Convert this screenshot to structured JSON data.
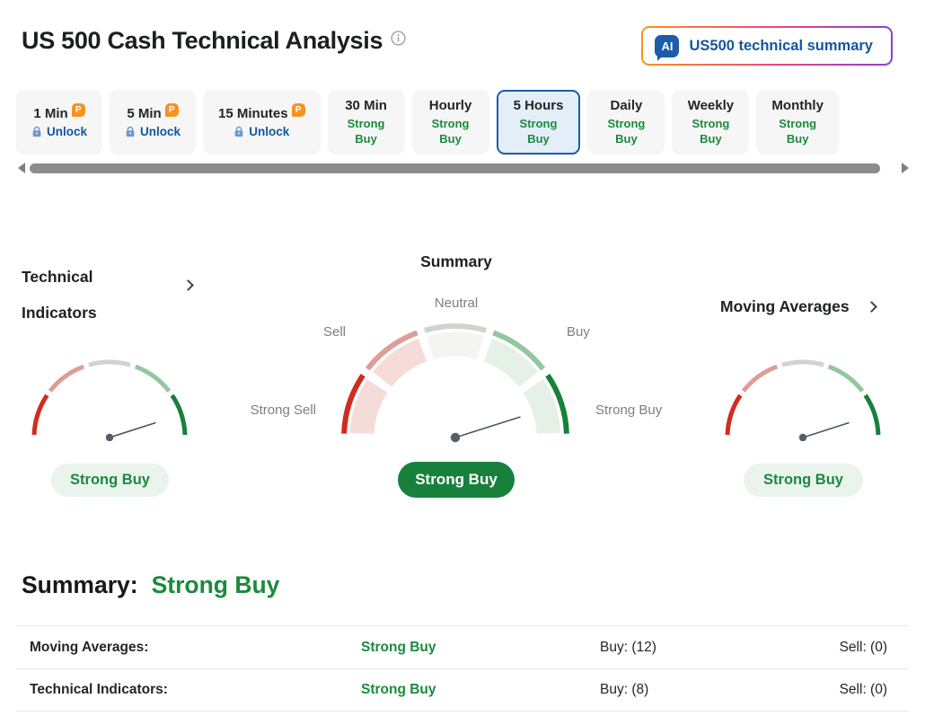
{
  "header": {
    "title": "US 500 Cash Technical Analysis",
    "ai_button": {
      "icon_label": "AI",
      "label": "US500 technical summary"
    }
  },
  "tabs": [
    {
      "label": "1 Min",
      "badge": "P",
      "status": "Unlock",
      "locked": true,
      "selected": false
    },
    {
      "label": "5 Min",
      "badge": "P",
      "status": "Unlock",
      "locked": true,
      "selected": false
    },
    {
      "label": "15 Minutes",
      "badge": "P",
      "status": "Unlock",
      "locked": true,
      "selected": false
    },
    {
      "label": "30 Min",
      "status": "Strong Buy",
      "locked": false,
      "selected": false
    },
    {
      "label": "Hourly",
      "status": "Strong Buy",
      "locked": false,
      "selected": false
    },
    {
      "label": "5 Hours",
      "status": "Strong Buy",
      "locked": false,
      "selected": true
    },
    {
      "label": "Daily",
      "status": "Strong Buy",
      "locked": false,
      "selected": false
    },
    {
      "label": "Weekly",
      "status": "Strong Buy",
      "locked": false,
      "selected": false
    },
    {
      "label": "Monthly",
      "status": "Strong Buy",
      "locked": false,
      "selected": false
    }
  ],
  "gauges": {
    "left": {
      "title": "Technical Indicators",
      "value": "Strong Buy"
    },
    "center": {
      "title": "Summary",
      "value": "Strong Buy",
      "scale_labels": {
        "strong_sell": "Strong Sell",
        "sell": "Sell",
        "neutral": "Neutral",
        "buy": "Buy",
        "strong_buy": "Strong Buy"
      }
    },
    "right": {
      "title": "Moving Averages",
      "value": "Strong Buy"
    }
  },
  "summary": {
    "heading": "Summary:",
    "value": "Strong Buy",
    "rows": [
      {
        "label": "Moving Averages:",
        "value": "Strong Buy",
        "buy": "Buy: (12)",
        "sell": "Sell: (0)"
      },
      {
        "label": "Technical Indicators:",
        "value": "Strong Buy",
        "buy": "Buy: (8)",
        "sell": "Sell: (0)"
      }
    ]
  },
  "colors": {
    "arc_strong_sell": "#D22B20",
    "arc_sell": "#DC9E97",
    "arc_neutral": "#D2D2D0",
    "arc_buy": "#92C7A0",
    "arc_strong_buy": "#17813B",
    "band_sell": "#F6DCD9",
    "band_neutral": "#F4F4F2",
    "band_buy": "#E5F1E7",
    "needle": "#4C5564",
    "pivot": "#535D6C",
    "green_text": "#1B8A3C",
    "pill_solid_bg": "#17813B",
    "pill_light_bg": "#EAF4ED",
    "blue_link": "#1256A0",
    "tab_bg": "#F6F6F6",
    "tab_selected_bg": "#E4EEF9",
    "tab_selected_border": "#1B5DAD",
    "scrollbar_thumb": "#8C8C8C",
    "divider": "#E6E6E6",
    "badge_orange": "#F7921E",
    "label_gray": "#7B7E83",
    "text_dark": "#232526",
    "ai_icon_bg": "#1D5CA8",
    "gradient_start": "#F7931A",
    "gradient_mid": "#E8457E",
    "gradient_end": "#8B3DD8"
  }
}
